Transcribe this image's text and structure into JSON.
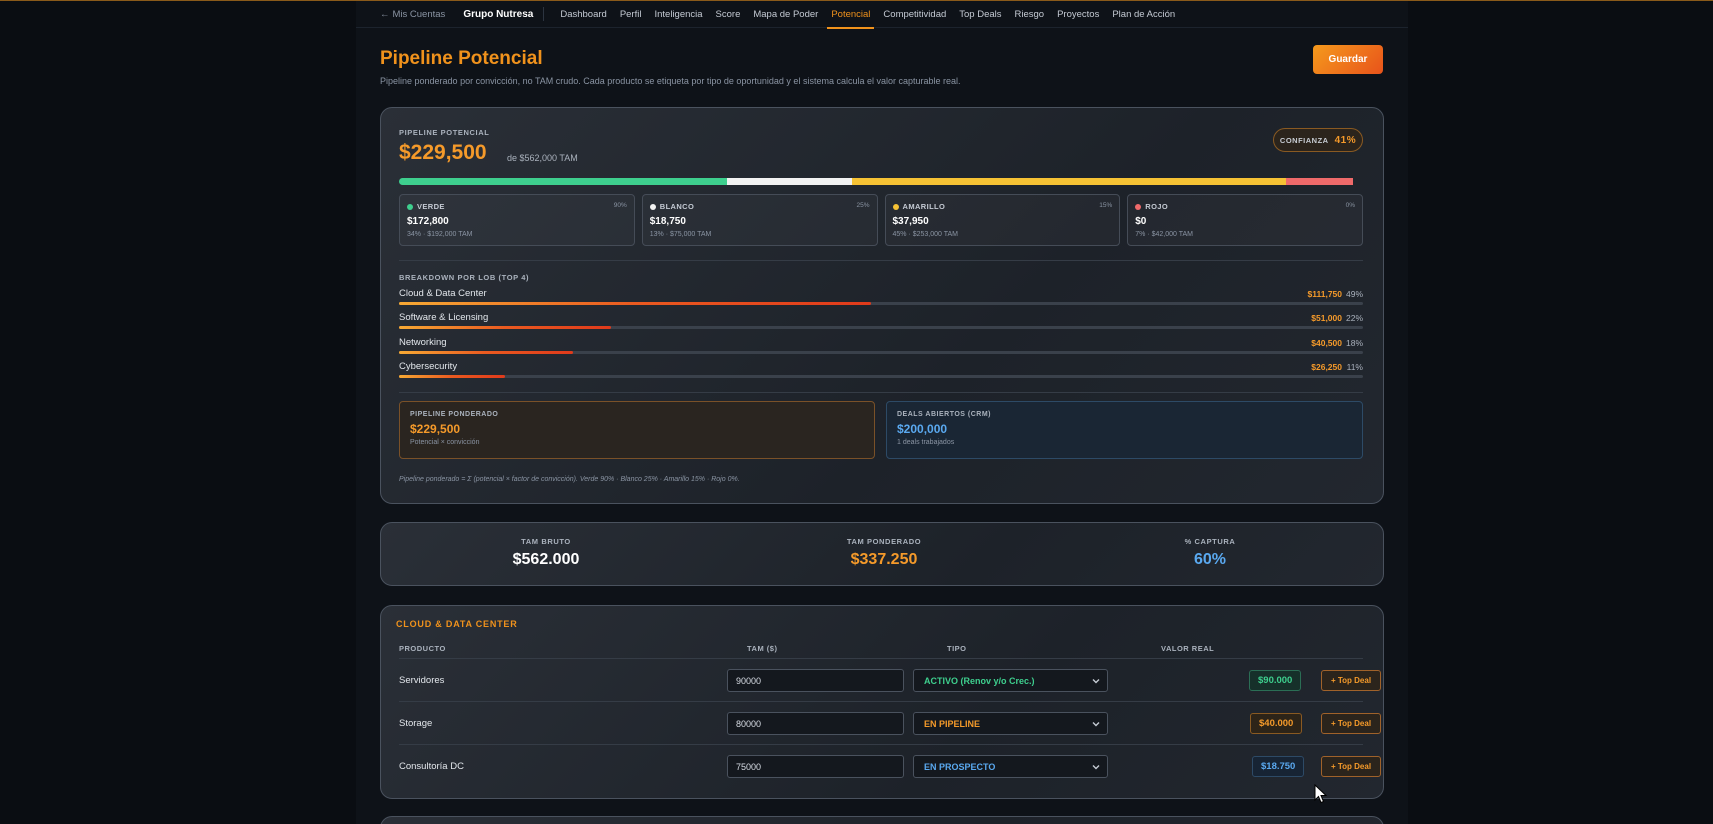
{
  "nav": {
    "back_label": "Mis Cuentas",
    "brand": "Grupo Nutresa",
    "tabs": [
      "Dashboard",
      "Perfil",
      "Inteligencia",
      "Score",
      "Mapa de Poder",
      "Potencial",
      "Competitividad",
      "Top Deals",
      "Riesgo",
      "Proyectos",
      "Plan de Acción"
    ],
    "active_tab": "Potencial"
  },
  "header": {
    "title": "Pipeline Potencial",
    "subtitle": "Pipeline ponderado por convicción, no TAM crudo. Cada producto se etiqueta por tipo de oportunidad y el sistema calcula el valor capturable real.",
    "save_label": "Guardar"
  },
  "summary": {
    "label": "PIPELINE POTENCIAL",
    "value": "$229,500",
    "tam_text": "de $562,000 TAM",
    "confidence_label": "CONFIANZA",
    "confidence_value": "41%",
    "segments": [
      {
        "name": "VERDE",
        "pct": "90%",
        "value": "$172,800",
        "sub": "34% · $192,000 TAM",
        "color": "#3ecf8e",
        "share": 34
      },
      {
        "name": "BLANCO",
        "pct": "25%",
        "value": "$18,750",
        "sub": "13% · $75,000 TAM",
        "color": "#f2f2f2",
        "share": 13
      },
      {
        "name": "AMARILLO",
        "pct": "15%",
        "value": "$37,950",
        "sub": "45% · $253,000 TAM",
        "color": "#f6c234",
        "share": 45
      },
      {
        "name": "ROJO",
        "pct": "0%",
        "value": "$0",
        "sub": "7% · $42,000 TAM",
        "color": "#ef6a6a",
        "share": 7
      }
    ],
    "lob_title": "BREAKDOWN POR LOB (TOP 4)",
    "lobs": [
      {
        "name": "Cloud & Data Center",
        "amount": "$111,750",
        "pct": "49%",
        "fill": 49
      },
      {
        "name": "Software & Licensing",
        "amount": "$51,000",
        "pct": "22%",
        "fill": 22
      },
      {
        "name": "Networking",
        "amount": "$40,500",
        "pct": "18%",
        "fill": 18
      },
      {
        "name": "Cybersecurity",
        "amount": "$26,250",
        "pct": "11%",
        "fill": 11
      }
    ],
    "weighted": {
      "label": "PIPELINE PONDERADO",
      "value": "$229,500",
      "sub": "Potencial × convicción"
    },
    "crm": {
      "label": "DEALS ABIERTOS (CRM)",
      "value": "$200,000",
      "sub": "1 deals trabajados"
    },
    "formula": "Pipeline ponderado = Σ (potencial × factor de convicción). Verde 90% · Blanco 25% · Amarillo 15% · Rojo 0%."
  },
  "kpis": [
    {
      "label": "TAM BRUTO",
      "value": "$562.000",
      "color": "#ffffff"
    },
    {
      "label": "TAM PONDERADO",
      "value": "$337.250",
      "color": "#f59a2a"
    },
    {
      "label": "% CAPTURA",
      "value": "60%",
      "color": "#5aa9f0"
    }
  ],
  "section": {
    "title": "CLOUD & DATA CENTER",
    "columns": [
      "PRODUCTO",
      "TAM ($)",
      "TIPO",
      "VALOR REAL"
    ],
    "top_deal_label": "+ Top Deal",
    "rows": [
      {
        "product": "Servidores",
        "tam": "90000",
        "tipo": "ACTIVO (Renov y/o Crec.)",
        "tipo_color": "#3ecf8e",
        "real": "$90.000",
        "real_color": "#3ecf8e",
        "real_bg": "#16302a",
        "real_border": "#2b6e55"
      },
      {
        "product": "Storage",
        "tam": "80000",
        "tipo": "EN PIPELINE",
        "tipo_color": "#f59a2a",
        "real": "$40.000",
        "real_color": "#f59a2a",
        "real_bg": "#2d2418",
        "real_border": "#8a5a22"
      },
      {
        "product": "Consultoría DC",
        "tam": "75000",
        "tipo": "EN PROSPECTO",
        "tipo_color": "#5aa9f0",
        "real": "$18.750",
        "real_color": "#5aa9f0",
        "real_bg": "#172434",
        "real_border": "#2d4a66"
      }
    ]
  }
}
